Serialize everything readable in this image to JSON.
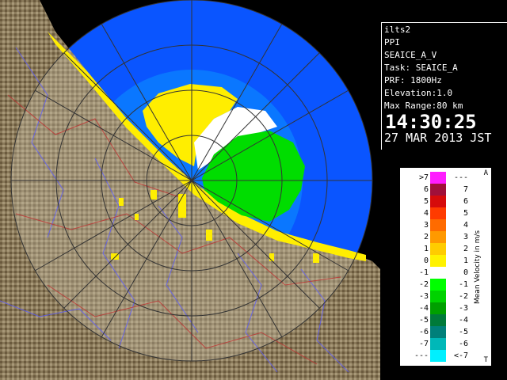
{
  "info": {
    "station": "ilts2",
    "mode": "PPI",
    "product": "SEAICE_A_V",
    "task": "Task: SEAICE_A",
    "prf": "PRF: 1800Hz",
    "elevation": "Elevation:1.0",
    "max_range": "Max Range:80 km",
    "time": "14:30:25",
    "date": "27 MAR 2013 JST"
  },
  "legend": {
    "title": "Mean Velocity in m/s",
    "top_mark": "A",
    "bottom_mark": "T",
    "rows": [
      {
        "left": ">7",
        "right": "---",
        "color": "#ff1dff"
      },
      {
        "left": "6",
        "right": "7",
        "color": "#a0103a"
      },
      {
        "left": "5",
        "right": "6",
        "color": "#d60b0b"
      },
      {
        "left": "4",
        "right": "5",
        "color": "#ff3b00"
      },
      {
        "left": "3",
        "right": "4",
        "color": "#ff6b00"
      },
      {
        "left": "2",
        "right": "3",
        "color": "#ff9900"
      },
      {
        "left": "1",
        "right": "2",
        "color": "#ffcc00"
      },
      {
        "left": "0",
        "right": "1",
        "color": "#fff200"
      },
      {
        "left": "-1",
        "right": "0",
        "color": "#ffffff"
      },
      {
        "left": "-2",
        "right": "-1",
        "color": "#00ff00"
      },
      {
        "left": "-3",
        "right": "-2",
        "color": "#00d200"
      },
      {
        "left": "-4",
        "right": "-3",
        "color": "#00a000"
      },
      {
        "left": "-5",
        "right": "-4",
        "color": "#007a3a"
      },
      {
        "left": "-6",
        "right": "-5",
        "color": "#00807a"
      },
      {
        "left": "-7",
        "right": "-6",
        "color": "#00b8b8"
      },
      {
        "left": "---",
        "right": "<-7",
        "color": "#00f0ff"
      }
    ]
  },
  "colors": {
    "ocean": "#0066ff",
    "outer_range": "#aab8cc",
    "land": "#8a7a5a",
    "approaching": "#00dd00",
    "receding": "#ffdd00",
    "near_zero": "#ffffff"
  }
}
